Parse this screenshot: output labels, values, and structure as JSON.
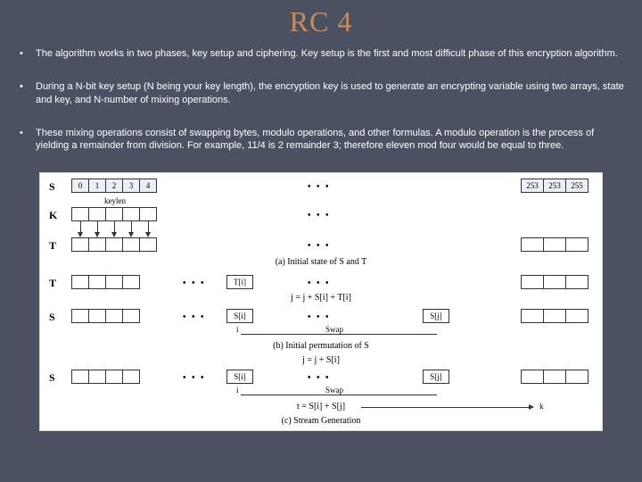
{
  "title": "RC 4",
  "bullets": [
    "The algorithm works in two phases, key setup and ciphering. Key setup is the first and most difficult phase of this encryption algorithm.",
    "During a N-bit key setup (N being your key length), the encryption key is used to generate an encrypting variable using two arrays, state and key, and N-number of mixing operations.",
    "These mixing operations consist of swapping bytes, modulo operations, and other formulas. A modulo operation is the process of yielding a remainder from division. For example, 11/4 is 2 remainder 3; therefore eleven mod four would be equal to three."
  ],
  "diagram": {
    "rowLabels": {
      "S": "S",
      "K": "K",
      "T": "T"
    },
    "sCells": [
      "0",
      "1",
      "2",
      "3",
      "4"
    ],
    "sTail": [
      "253",
      "253",
      "255"
    ],
    "keylen": "keylen",
    "captions": {
      "a": "(a) Initial state of S and T",
      "b": "(b) Initial permutation of S",
      "c": "(c) Stream Generation"
    },
    "formulas": {
      "b": "j = j + S[i] + T[i]",
      "c1": "j = j + S[i]",
      "c2": "t = S[i] + S[j]"
    },
    "tags": {
      "Ti": "T[i]",
      "Si": "S[i]",
      "Sj": "S[j]",
      "k": "k",
      "i": "i"
    },
    "swap": "Swap"
  }
}
